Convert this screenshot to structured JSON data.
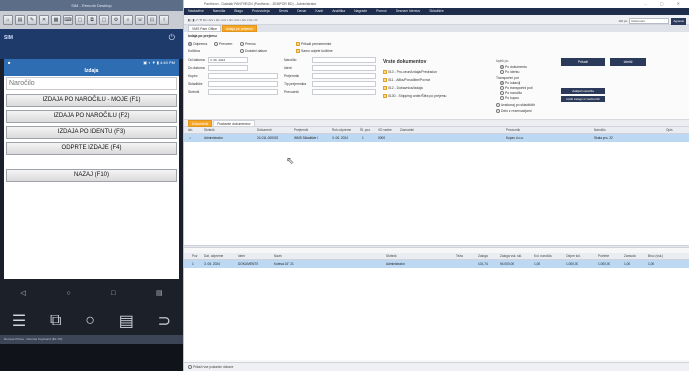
{
  "emulator": {
    "title": "SIM - Remote Desktop",
    "sim_label": "SIM",
    "power_icon": "power-icon",
    "phone_status_left": "■",
    "phone_status_right": "▣ ◐ ▼ ▮ 4:40 PM",
    "app_title": "Izdaja",
    "search_placeholder": "Naročilo",
    "buttons": [
      "IZDAJA PO NAROČILU - MOJE (F1)",
      "IZDAJA PO NAROČILU (F2)",
      "IZDAJA PO IDENTU (F3)",
      "ODPRTE IZDAJE (F4)",
      "NAZAJ (F10)"
    ],
    "nav": [
      "◁",
      "○",
      "□",
      "▤"
    ],
    "nav2": [
      "☰",
      "⧉",
      "○",
      "▤",
      "⊃"
    ],
    "taskbar": "Remote Phone - Remote Keyboard (BL-TD)"
  },
  "erp": {
    "title": "Pantheon - Datalab PANTHEON (Pantheon - ZEMPOR BD) - Administrator",
    "window_controls": "– ▢ ✕",
    "menu": [
      "Nastavitve",
      "Naročila",
      "Blago",
      "Proizvodnja",
      "Servis",
      "Denar",
      "Kadri",
      "Analitika",
      "Nagrade",
      "Pomoč",
      "Seznam Identov",
      "Skladišče"
    ],
    "toolbar_text": "◧ ◨ ⤺ ⟲ Izv ▪ Izv ▪ Izv ▪ Izv ▪ Izv ▪ Izv ▪ Izv ▪ Izv ▪ Iz",
    "toolbar_combo_label": "Išči po",
    "toolbar_combo_value": "Dokument",
    "toolbar_button": "Agnesis",
    "tabs": [
      "VMS Pam Office",
      "Izdaja po prejemu"
    ],
    "head": {
      "section": "Izdaja po prejemu",
      "radio_items": [
        "Odprema",
        "Prevzem",
        "Prenos"
      ],
      "checks": [
        "Prikaži prevzemnike",
        "Samo odprte količine"
      ],
      "label_kolicina": "Količina",
      "label_dodatni": "Dodatni datum",
      "fields": [
        {
          "label": "Od datuma",
          "value": "3. 06. 2024"
        },
        {
          "label": "Do datuma",
          "value": ""
        },
        {
          "label": "Kupec",
          "value": ""
        },
        {
          "label": "Skladišče",
          "value": ""
        },
        {
          "label": "Skrbnik",
          "value": ""
        }
      ],
      "fields_mid": [
        {
          "label": "Naročilo",
          "value": ""
        },
        {
          "label": "Ident",
          "value": ""
        },
        {
          "label": "Prejemnik",
          "value": ""
        },
        {
          "label": "Tip prejemnika",
          "value": ""
        },
        {
          "label": "Prevoznik",
          "value": ""
        }
      ],
      "doc_title": "Vrste dokumentov",
      "doc_types": [
        "010 - Pro-ceun/Izdaja/Predračun",
        "011 - Afiks/Porudžbe/Povrat",
        "012 - Dobavnica/Izdaja",
        "0130 - Shipping order/Šifra po prejemu"
      ],
      "side_title": "Izpiši po",
      "side_items": [
        "Po dokumentu",
        "Po identu",
        "Transportni pot",
        "Po lokaciji",
        "Po transportni poti",
        "Po naročilu",
        "Po kupcu",
        "Izračunaj po skladiščih",
        "Delo z rezervacijami"
      ],
      "btn_prikazi": "Prikaži",
      "btn_izbrisi": "Izbriši",
      "btn_zakljuci": "Zaključi naročila",
      "btn_izpisi": "Izpiši zalogo iz nadzornih"
    },
    "subtabs": [
      "Dokumenti",
      "Postavke dokumentov"
    ],
    "grid1": {
      "headers": [
        "Izb.",
        "Skrbnik",
        "Dokument",
        "Prejemnik",
        "Rok odpreme",
        "Št. poz.",
        "VD vsebe",
        "Zaznamki",
        "Prevoznik",
        "Naročilo",
        "Opis"
      ],
      "row": [
        "✓",
        "Administrator",
        "24-011-000002",
        "WMS Skladišče I",
        "3. 06. 2024",
        "1",
        "0000",
        "",
        "Kupec d.o.o.",
        "Skala pro. 22",
        ""
      ]
    },
    "grid2": {
      "headers": [
        "Poz",
        "Dat. odpreme",
        "Ident",
        "Naziv",
        "Skrbnik",
        "Teža",
        "Zaloga",
        "Zaloga vsk. skl.",
        "Kol. naročila",
        "Odpre kol.",
        "Potrebe",
        "Zamuda",
        "Bruc (vsk.)"
      ],
      "row": [
        "1",
        "3. 06. 2024",
        "DOKUMENTS",
        "Kolesa 24\" 21",
        "Administrator",
        "",
        "101,74",
        "94.000,00",
        "1,00",
        "1.000,00",
        "1.000,00",
        "1,00",
        "1,00"
      ]
    },
    "status": "Prikaži vse postavke dobave"
  }
}
